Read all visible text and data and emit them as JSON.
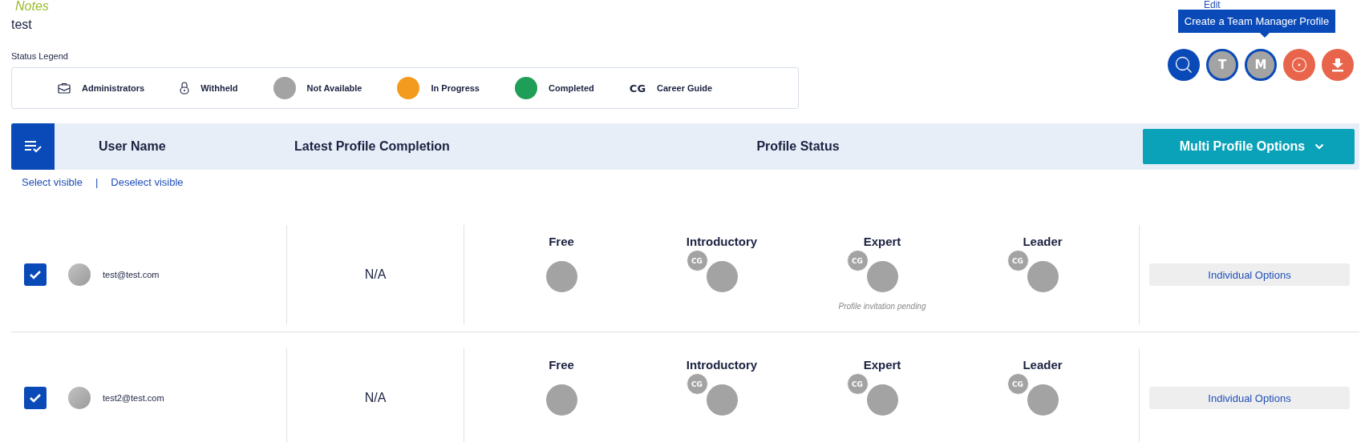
{
  "notes": {
    "title": "Notes",
    "text": "test"
  },
  "edit_link": "Edit",
  "tooltip": "Create a Team Manager Profile",
  "actions": [
    {
      "kind": "search"
    },
    {
      "kind": "letter",
      "text": "T"
    },
    {
      "kind": "letter",
      "text": "M"
    },
    {
      "kind": "cancel"
    },
    {
      "kind": "download"
    }
  ],
  "legend": {
    "title": "Status Legend",
    "items": [
      {
        "kind": "briefcase",
        "label": "Administrators"
      },
      {
        "kind": "lock",
        "label": "Withheld"
      },
      {
        "kind": "dot",
        "color": "#a3a3a3",
        "label": "Not Available"
      },
      {
        "kind": "dot",
        "color": "#f29b1f",
        "label": "In Progress"
      },
      {
        "kind": "dot",
        "color": "#1e9e56",
        "label": "Completed"
      },
      {
        "kind": "mark",
        "text": "CG",
        "label": "Career Guide"
      }
    ]
  },
  "table": {
    "columns": [
      "User Name",
      "Latest Profile Completion",
      "Profile Status"
    ],
    "multi_button": "Multi Profile Options",
    "select_visible": "Select visible",
    "separator": "|",
    "deselect_visible": "Deselect visible",
    "rows": [
      {
        "checked": true,
        "email": "test@test.com",
        "latest": "N/A",
        "option_button": "Individual Options",
        "levels": [
          {
            "label": "Free",
            "cg": false,
            "color": "#a3a3a3"
          },
          {
            "label": "Introductory",
            "cg": true,
            "badge": "CG",
            "color": "#a3a3a3"
          },
          {
            "label": "Expert",
            "cg": true,
            "badge": "CG",
            "color": "#a3a3a3",
            "note": "Profile invitation pending"
          },
          {
            "label": "Leader",
            "cg": true,
            "badge": "CG",
            "color": "#a3a3a3"
          }
        ]
      },
      {
        "checked": true,
        "email": "test2@test.com",
        "latest": "N/A",
        "option_button": "Individual Options",
        "levels": [
          {
            "label": "Free",
            "cg": false,
            "color": "#a3a3a3"
          },
          {
            "label": "Introductory",
            "cg": true,
            "badge": "CG",
            "color": "#a3a3a3"
          },
          {
            "label": "Expert",
            "cg": true,
            "badge": "CG",
            "color": "#a3a3a3"
          },
          {
            "label": "Leader",
            "cg": true,
            "badge": "CG",
            "color": "#a3a3a3"
          }
        ]
      }
    ]
  }
}
